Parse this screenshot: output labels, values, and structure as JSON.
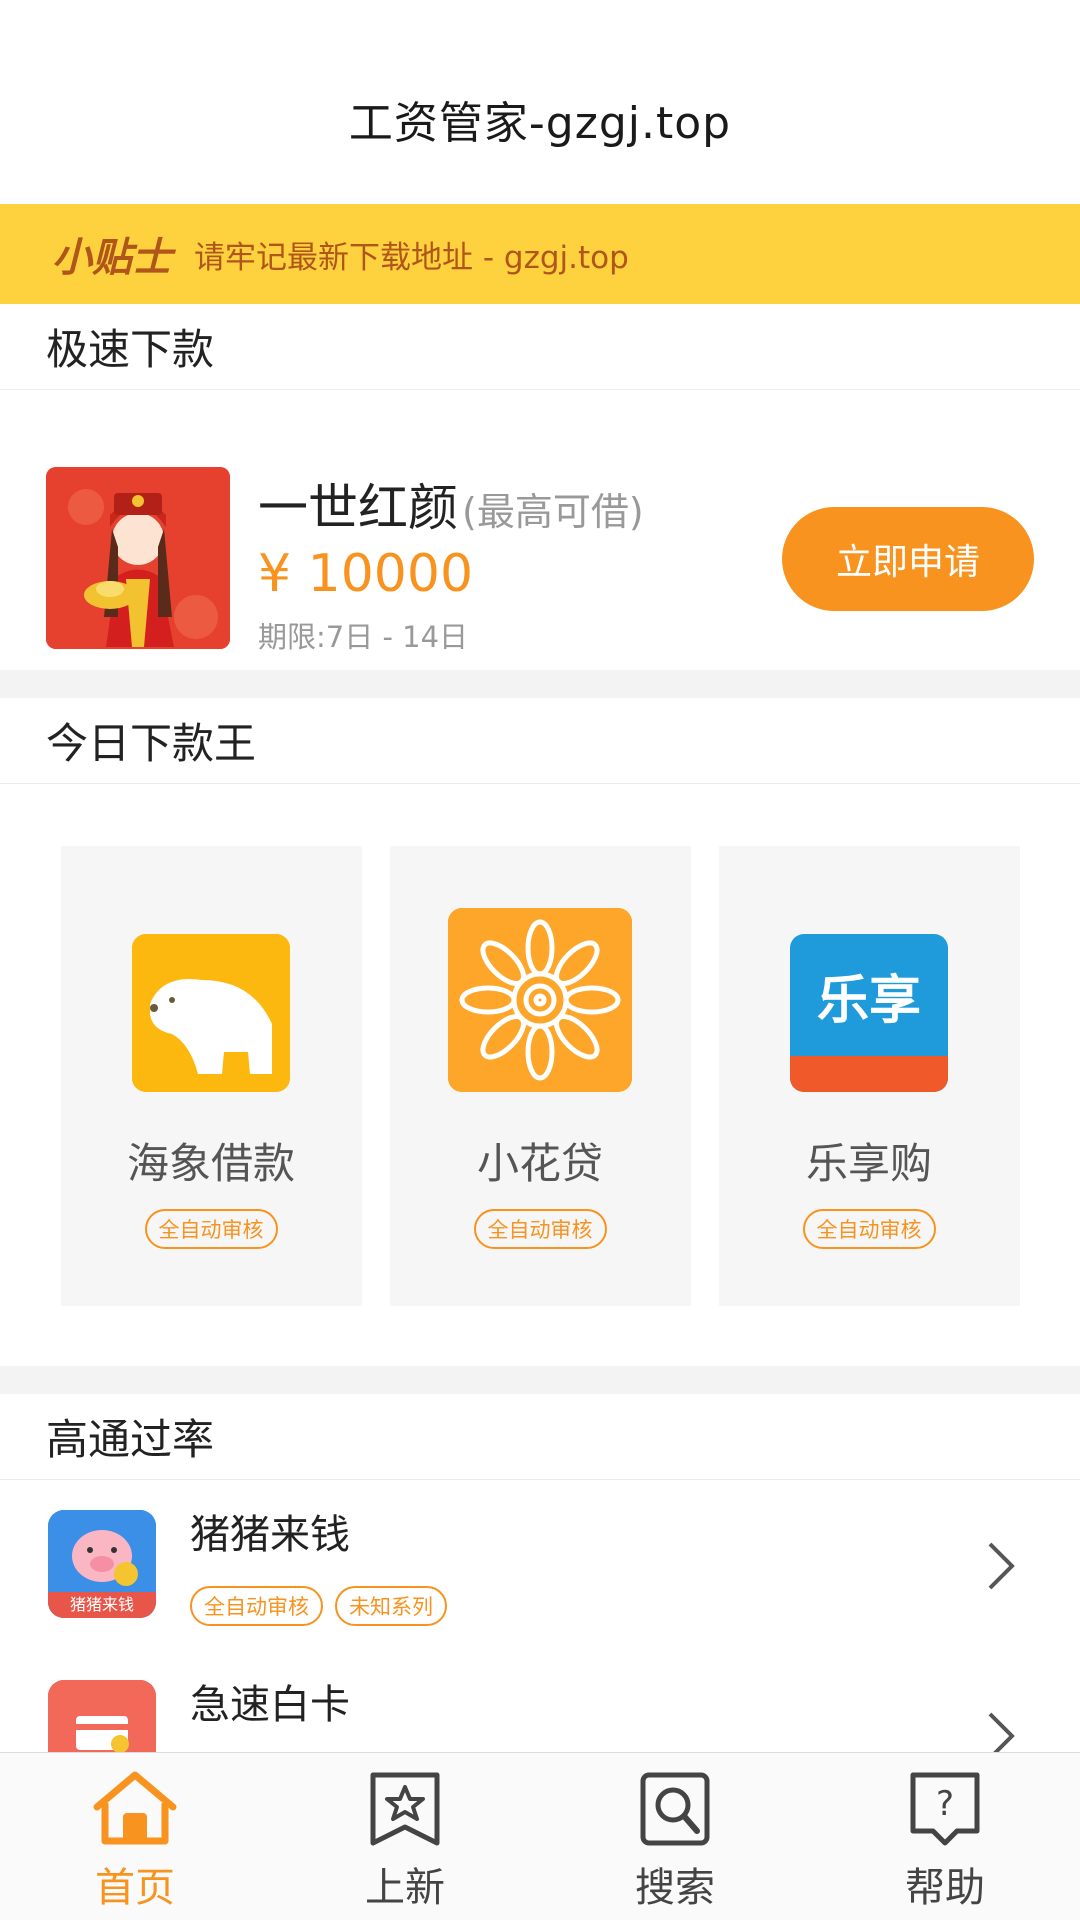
{
  "header": {
    "title": "工资管家-gzgj.top"
  },
  "tip": {
    "tag": "小贴士",
    "message": "请牢记最新下载地址 - gzgj.top"
  },
  "featured_section": {
    "title": "极速下款",
    "item": {
      "name": "一世红颜",
      "sub": "(最高可借)",
      "amount": "¥ 10000",
      "term": "期限:7日 - 14日",
      "button": "立即申请"
    }
  },
  "today_section": {
    "title": "今日下款王",
    "cards": [
      {
        "name": "海象借款",
        "badge": "全自动审核",
        "icon": "polar-bear-icon"
      },
      {
        "name": "小花贷",
        "badge": "全自动审核",
        "icon": "sun-flower-icon"
      },
      {
        "name": "乐享购",
        "badge": "全自动审核",
        "icon": "lexiang-logo-icon",
        "icon_text": "乐享"
      }
    ]
  },
  "high_section": {
    "title": "高通过率",
    "items": [
      {
        "name": "猪猪来钱",
        "badges": [
          "全自动审核",
          "未知系列"
        ],
        "icon": "pig-icon",
        "icon_text": "猪猪来钱"
      },
      {
        "name": "急速白卡",
        "badges": [],
        "icon": "card-icon"
      }
    ]
  },
  "tabbar": {
    "tabs": [
      {
        "label": "首页",
        "icon": "home-icon",
        "active": true
      },
      {
        "label": "上新",
        "icon": "bookmark-star-icon",
        "active": false
      },
      {
        "label": "搜索",
        "icon": "search-icon",
        "active": false
      },
      {
        "label": "帮助",
        "icon": "help-icon",
        "active": false
      }
    ]
  },
  "colors": {
    "accent": "#f7931e",
    "tip_bg": "#fdd23e",
    "tip_text": "#b1561a"
  }
}
